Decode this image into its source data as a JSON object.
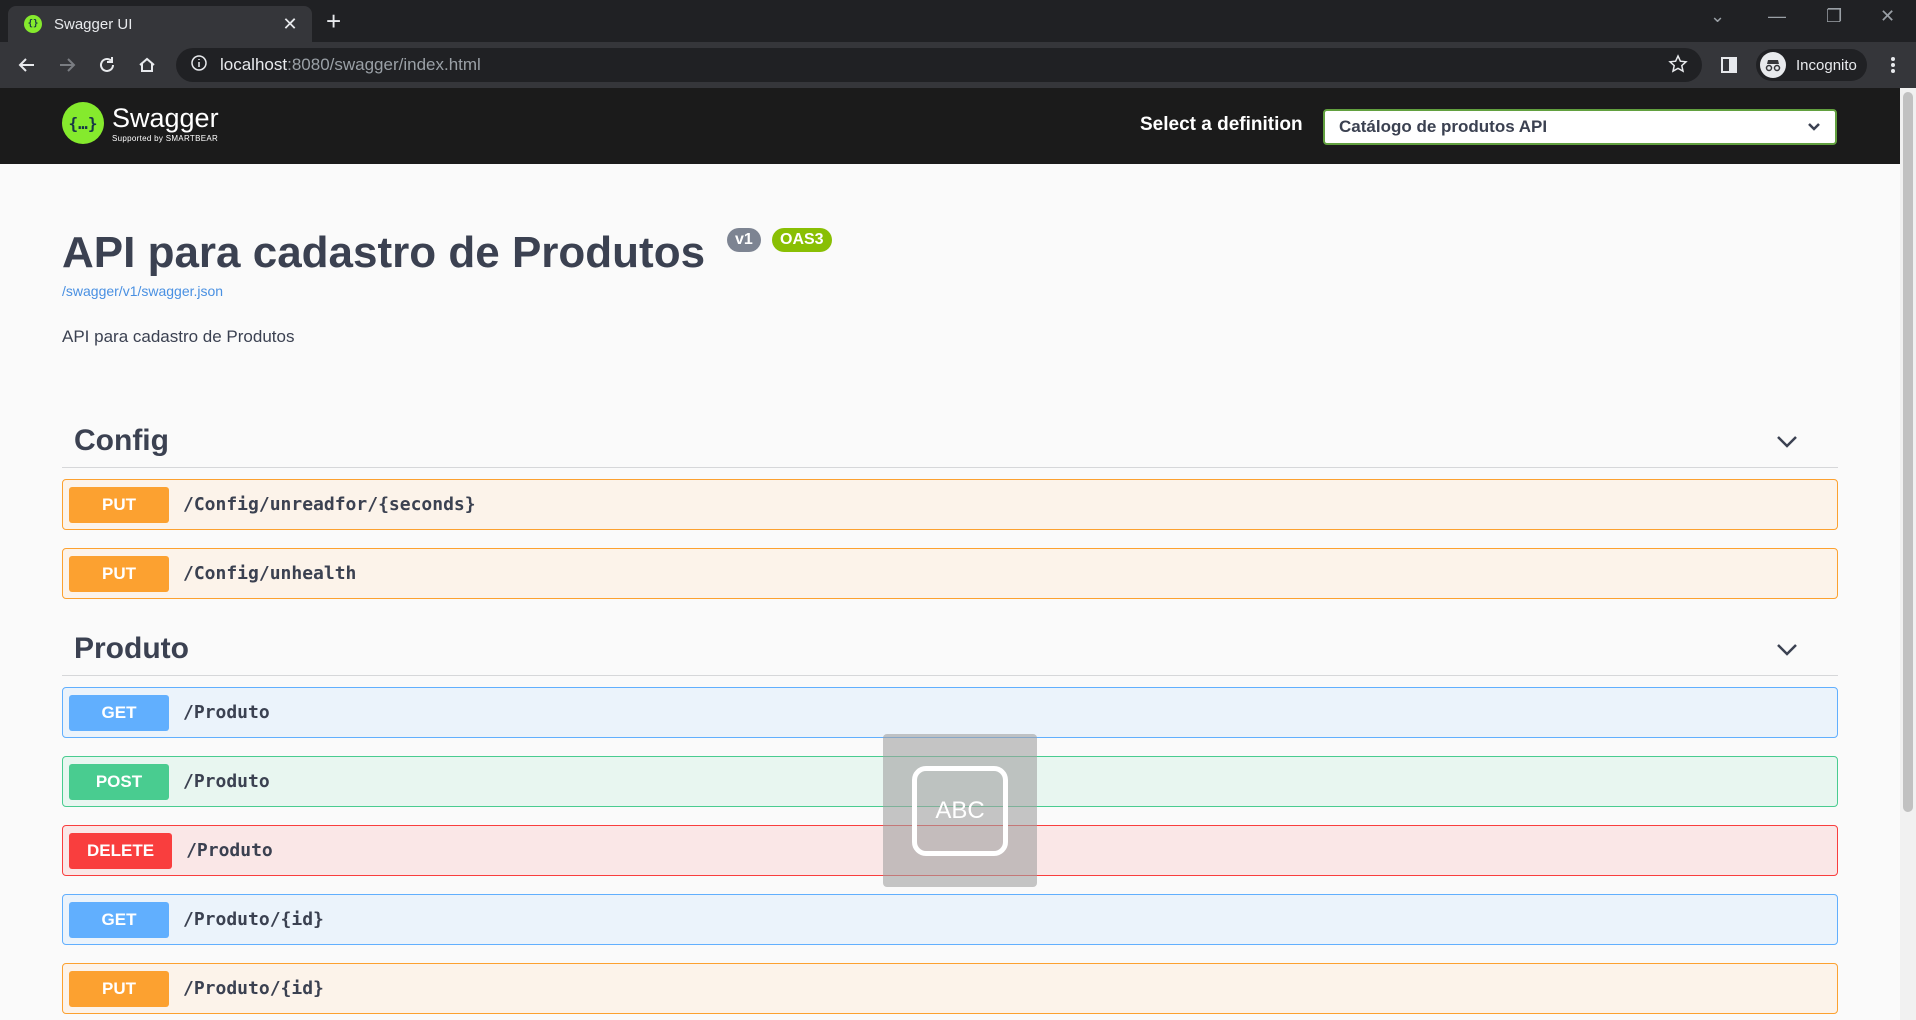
{
  "browser": {
    "tab_title": "Swagger UI",
    "url_host": "localhost",
    "url_rest": ":8080/swagger/index.html",
    "profile_label": "Incognito"
  },
  "topbar": {
    "logo_name": "Swagger",
    "logo_sub": "Supported by SMARTBEAR",
    "definition_label": "Select a definition",
    "definition_value": "Catálogo de produtos API"
  },
  "info": {
    "title": "API para cadastro de Produtos",
    "version_badge": "v1",
    "oas_badge": "OAS3",
    "spec_link": "/swagger/v1/swagger.json",
    "description": "API para cadastro de Produtos"
  },
  "sections": [
    {
      "name": "Config",
      "operations": [
        {
          "method": "PUT",
          "path": "/Config/unreadfor/{seconds}"
        },
        {
          "method": "PUT",
          "path": "/Config/unhealth"
        }
      ]
    },
    {
      "name": "Produto",
      "operations": [
        {
          "method": "GET",
          "path": "/Produto"
        },
        {
          "method": "POST",
          "path": "/Produto"
        },
        {
          "method": "DELETE",
          "path": "/Produto"
        },
        {
          "method": "GET",
          "path": "/Produto/{id}"
        },
        {
          "method": "PUT",
          "path": "/Produto/{id}"
        }
      ]
    }
  ],
  "overlay": {
    "label": "ABC"
  },
  "colors": {
    "put": "#fca130",
    "get": "#61affe",
    "post": "#49cc90",
    "delete": "#f93e3e",
    "swagger_green": "#85ea2d"
  }
}
